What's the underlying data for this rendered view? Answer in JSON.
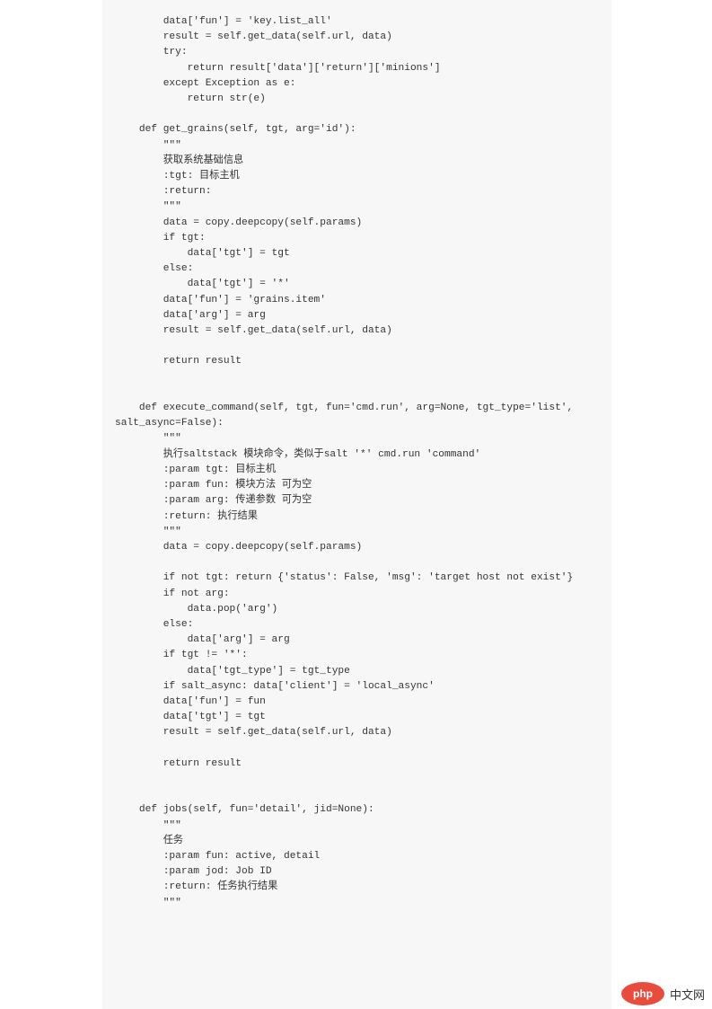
{
  "code": "        data['fun'] = 'key.list_all'\n        result = self.get_data(self.url, data)\n        try:\n            return result['data']['return']['minions']\n        except Exception as e:\n            return str(e)\n\n    def get_grains(self, tgt, arg='id'):\n        \"\"\"\n        获取系统基础信息\n        :tgt: 目标主机\n        :return:\n        \"\"\"\n        data = copy.deepcopy(self.params)\n        if tgt:\n            data['tgt'] = tgt\n        else:\n            data['tgt'] = '*'\n        data['fun'] = 'grains.item'\n        data['arg'] = arg\n        result = self.get_data(self.url, data)\n\n        return result\n\n\n    def execute_command(self, tgt, fun='cmd.run', arg=None, tgt_type='list',\nsalt_async=False):\n        \"\"\"\n        执行saltstack 模块命令，类似于salt '*' cmd.run 'command'\n        :param tgt: 目标主机\n        :param fun: 模块方法 可为空\n        :param arg: 传递参数 可为空\n        :return: 执行结果\n        \"\"\"\n        data = copy.deepcopy(self.params)\n\n        if not tgt: return {'status': False, 'msg': 'target host not exist'}\n        if not arg:\n            data.pop('arg')\n        else:\n            data['arg'] = arg\n        if tgt != '*':\n            data['tgt_type'] = tgt_type\n        if salt_async: data['client'] = 'local_async'\n        data['fun'] = fun\n        data['tgt'] = tgt\n        result = self.get_data(self.url, data)\n\n        return result\n\n\n    def jobs(self, fun='detail', jid=None):\n        \"\"\"\n        任务\n        :param fun: active, detail\n        :param jod: Job ID\n        :return: 任务执行结果\n        \"\"\"",
  "logo": {
    "text": "中文网",
    "php": "php"
  }
}
